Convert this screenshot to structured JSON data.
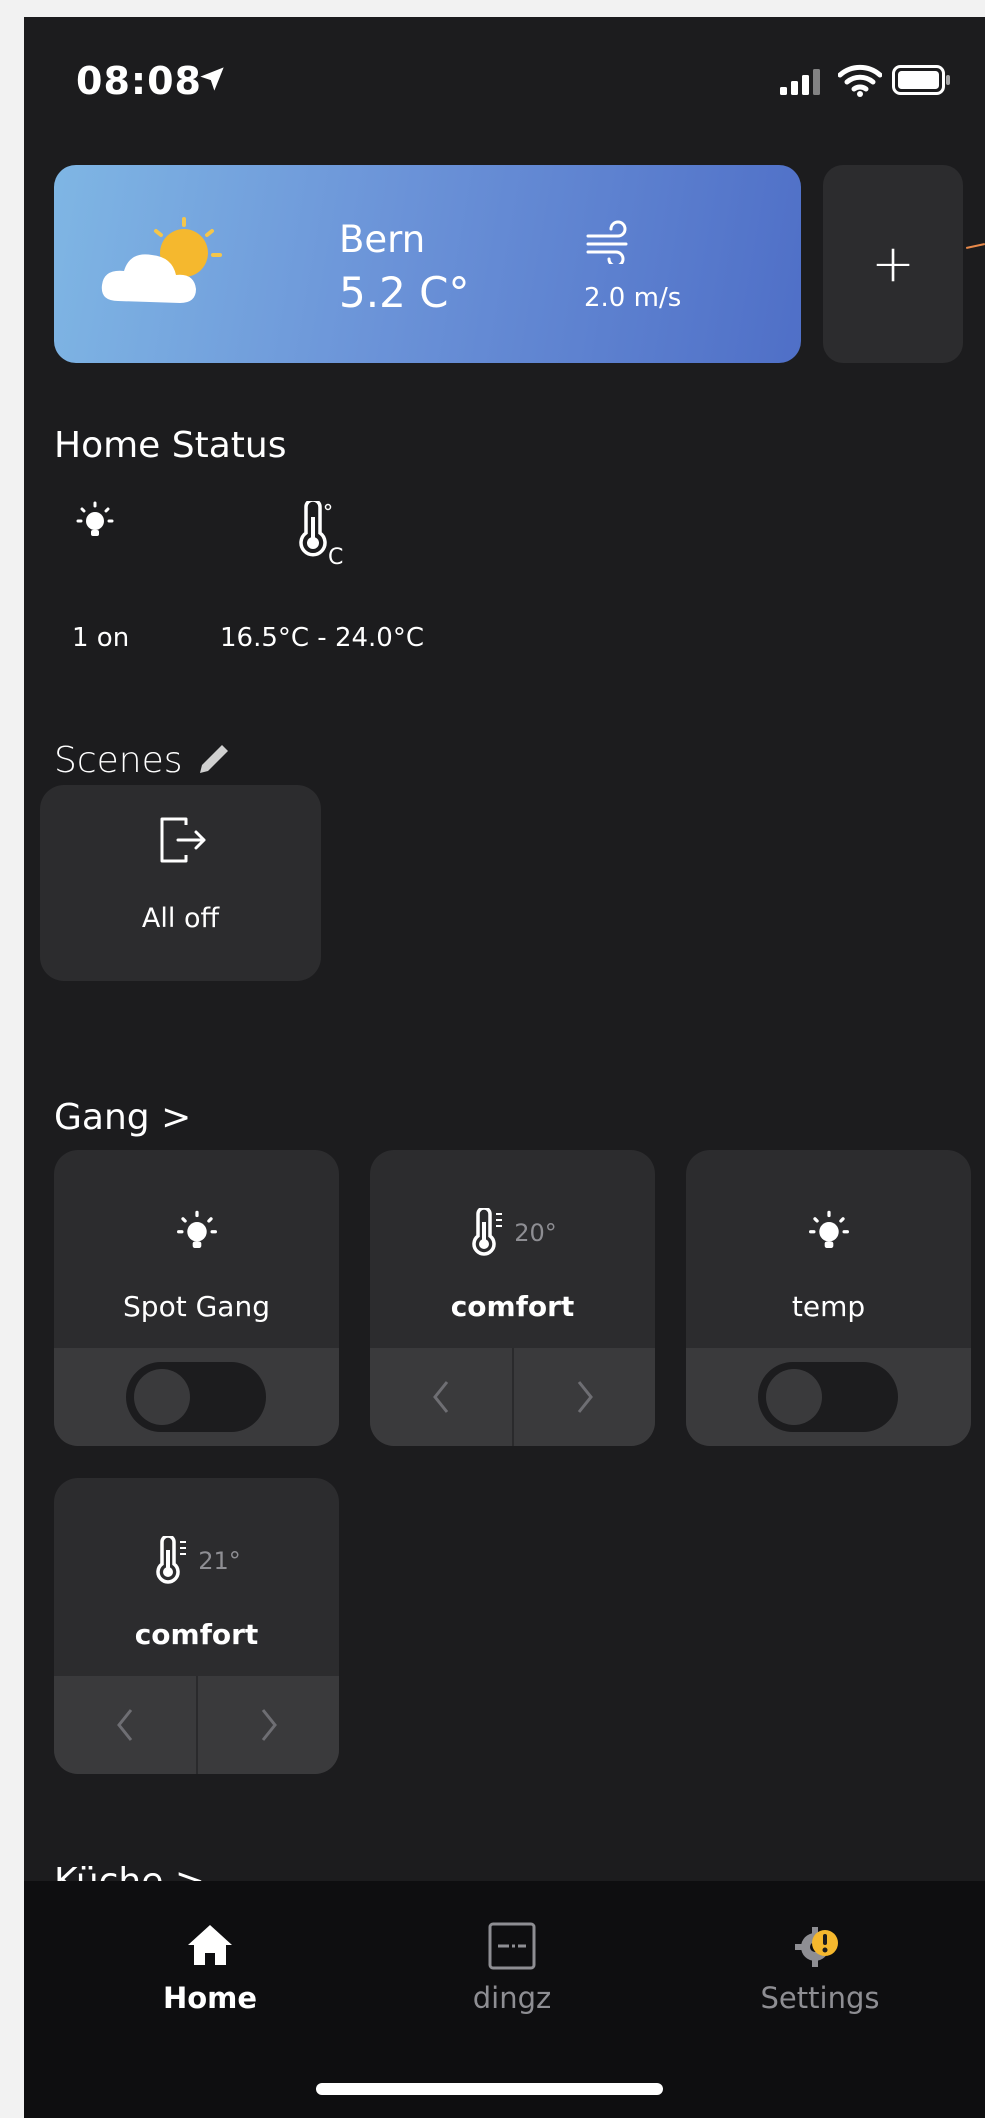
{
  "status_bar": {
    "time": "08:08"
  },
  "weather": {
    "city": "Bern",
    "temperature": "5.2 C°",
    "wind": "2.0 m/s"
  },
  "add_button": "+",
  "home_status": {
    "title": "Home Status",
    "lights_value": "1 on",
    "temp_range": "16.5°C - 24.0°C",
    "temp_unit_glyph": "C",
    "degree_glyph": "°"
  },
  "scenes": {
    "title": "Scenes",
    "items": [
      {
        "label": "All off"
      }
    ]
  },
  "gang": {
    "title": "Gang",
    "chevron": ">",
    "tiles": [
      {
        "label": "Spot Gang",
        "type": "light"
      },
      {
        "label": "comfort",
        "type": "thermostat",
        "setpoint": "20°"
      },
      {
        "label": "temp",
        "type": "light"
      },
      {
        "label": "comfort",
        "type": "thermostat",
        "setpoint": "21°"
      }
    ]
  },
  "kueche": {
    "title": "Küche",
    "chevron": ">"
  },
  "tabs": [
    {
      "label": "Home",
      "active": true
    },
    {
      "label": "dingz",
      "active": false
    },
    {
      "label": "Settings",
      "active": false
    }
  ],
  "colors": {
    "background": "#1c1c1e",
    "card": "#2c2c2e",
    "accent_warning": "#f5b82e",
    "weather_gradient_start": "#7fb6e4",
    "weather_gradient_end": "#4f6fc7"
  }
}
